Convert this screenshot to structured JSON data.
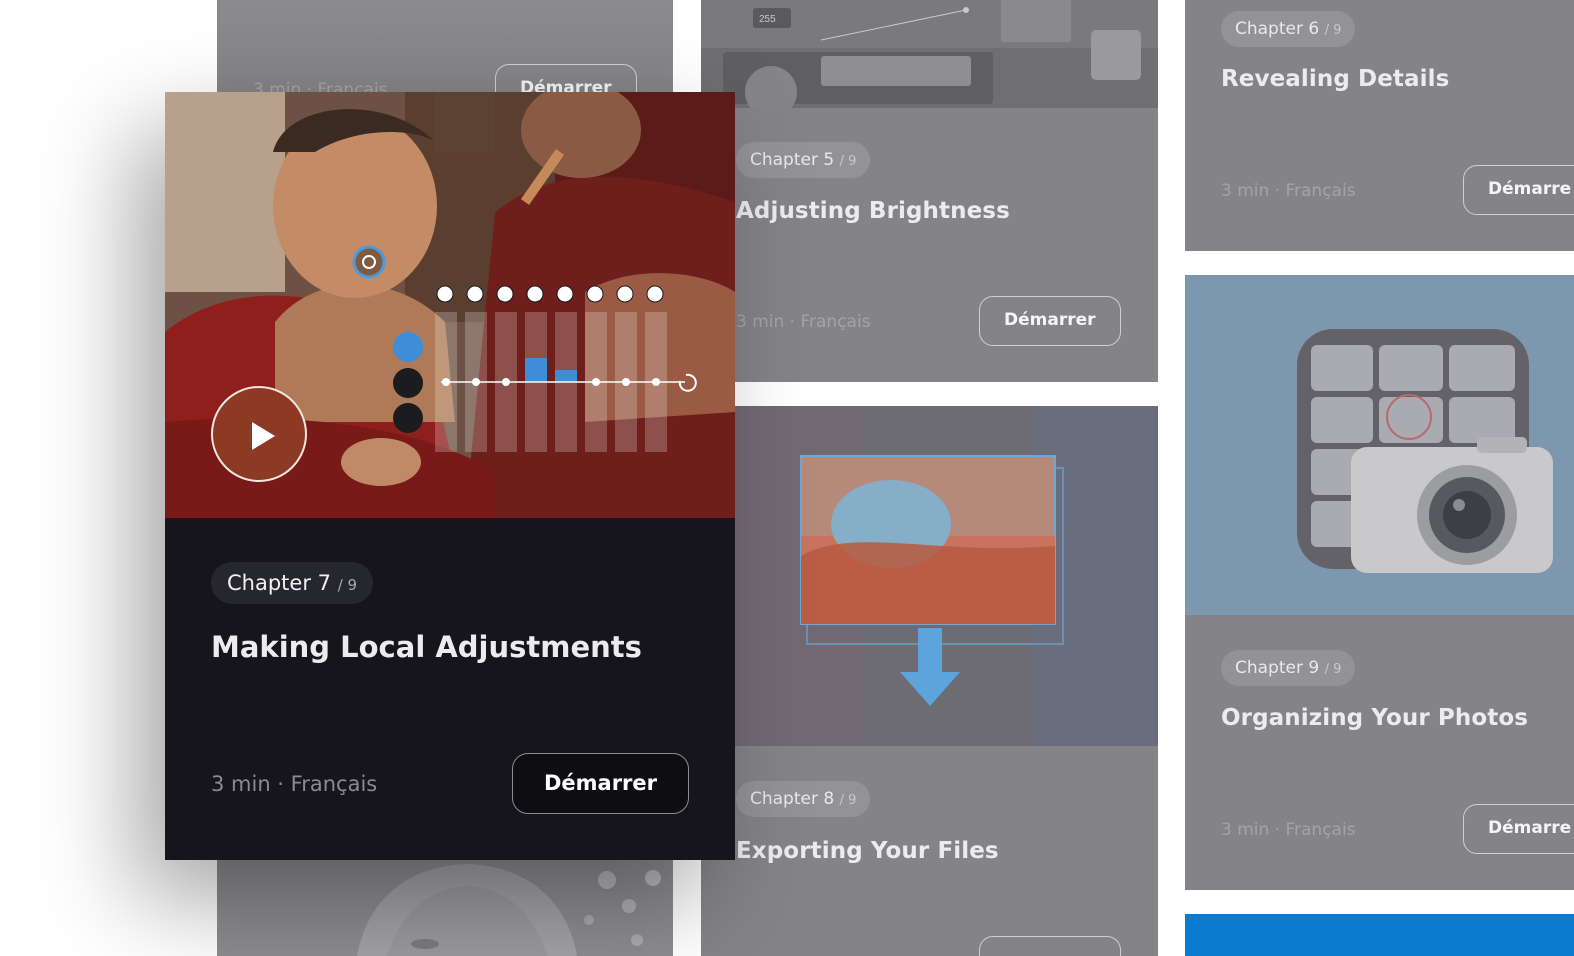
{
  "cards": {
    "top_partial": {
      "meta": "3 min · Français",
      "button": "Démarrer"
    },
    "chapter5": {
      "chapter_label": "Chapter 5",
      "chapter_total": "/ 9",
      "title": "Adjusting Brightness",
      "meta": "3 min · Français",
      "button": "Démarrer"
    },
    "chapter6": {
      "chapter_label": "Chapter 6",
      "chapter_total": "/ 9",
      "title": "Revealing Details",
      "meta": "3 min · Français",
      "button": "Démarre"
    },
    "chapter7": {
      "chapter_label": "Chapter 7",
      "chapter_total": "/ 9",
      "title": "Making Local Adjustments",
      "meta": "3 min · Français",
      "button": "Démarrer"
    },
    "chapter8": {
      "chapter_label": "Chapter 8",
      "chapter_total": "/ 9",
      "title": "Exporting Your Files"
    },
    "chapter9": {
      "chapter_label": "Chapter 9",
      "chapter_total": "/ 9",
      "title": "Organizing Your Photos",
      "meta": "3 min · Français",
      "button": "Démarre"
    }
  },
  "overlay": {
    "level_value": "255"
  },
  "colors": {
    "accent_blue": "#3d8ed6",
    "card_dim": "#848388",
    "card_featured": "#15151b",
    "bottom_strip": "#0a7bd0"
  }
}
